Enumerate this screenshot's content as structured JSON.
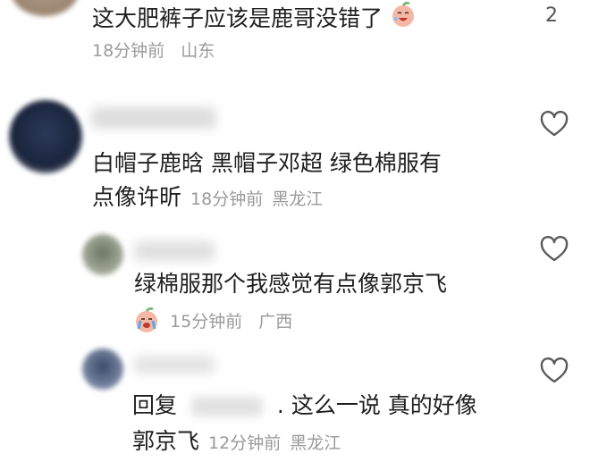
{
  "comments": [
    {
      "text": "这大肥裤子应该是鹿哥没错了",
      "time": "18分钟前",
      "location": "山东",
      "like_count": "2"
    },
    {
      "text_line1": "白帽子鹿晗 黑帽子邓超 绿色棉服有",
      "text_line2": "点像许昕",
      "time": "18分钟前",
      "location": "黑龙江"
    },
    {
      "text": "绿棉服那个我感觉有点像郭京飞",
      "time": "15分钟前",
      "location": "广西"
    },
    {
      "reply_prefix": "回复",
      "text_line1": ". 这么一说 真的好像",
      "text_line2": "郭京飞",
      "time": "12分钟前",
      "location": "黑龙江"
    }
  ],
  "icons": {
    "like": "heart-outline-icon",
    "emoji": "laughing-peach-emoji"
  },
  "colors": {
    "text": "#1f1f1f",
    "meta": "#9a9a9a",
    "icon": "#5a5a5a"
  }
}
